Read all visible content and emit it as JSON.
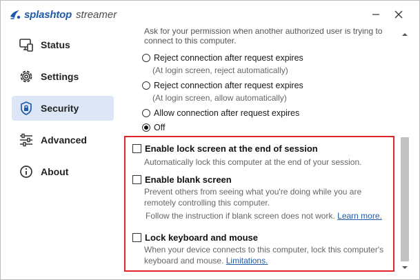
{
  "app": {
    "brand": "splashtop",
    "product": "streamer"
  },
  "sidebar": {
    "items": [
      {
        "label": "Status",
        "icon": "monitor-status-icon",
        "active": false
      },
      {
        "label": "Settings",
        "icon": "gear-icon",
        "active": false
      },
      {
        "label": "Security",
        "icon": "shield-lock-icon",
        "active": true
      },
      {
        "label": "Advanced",
        "icon": "sliders-icon",
        "active": false
      },
      {
        "label": "About",
        "icon": "info-icon",
        "active": false
      }
    ]
  },
  "content": {
    "cut_text": "Ask for your permission when another authorized user is trying to connect to this computer.",
    "radio_options": [
      {
        "label": "Reject connection after request expires",
        "note": "(At login screen, reject automatically)",
        "checked": false
      },
      {
        "label": "Reject connection after request expires",
        "note": "(At login screen, allow automatically)",
        "checked": false
      },
      {
        "label": "Allow connection after request expires",
        "note": "",
        "checked": false
      },
      {
        "label": "Off",
        "note": "",
        "checked": true
      }
    ],
    "lock_screen": {
      "label": "Enable lock screen at the end of session",
      "description": "Automatically lock this computer at the end of your session.",
      "checked": false
    },
    "blank_screen": {
      "label": "Enable blank screen",
      "description": "Prevent others from seeing what you're doing while you are remotely controlling this computer.",
      "instruction": "Follow the instruction if blank screen does not work.",
      "link": "Learn more.",
      "checked": false
    },
    "lock_keyboard": {
      "label": "Lock keyboard and mouse",
      "description": "When your device connects to this computer, lock this computer's keyboard and mouse.",
      "link": "Limitations.",
      "checked": false
    }
  },
  "colors": {
    "brand_blue": "#1f5aa6",
    "active_bg": "#dce6f7",
    "highlight_red": "#e2232a",
    "scroll_thumb": "#c2c2c2"
  }
}
